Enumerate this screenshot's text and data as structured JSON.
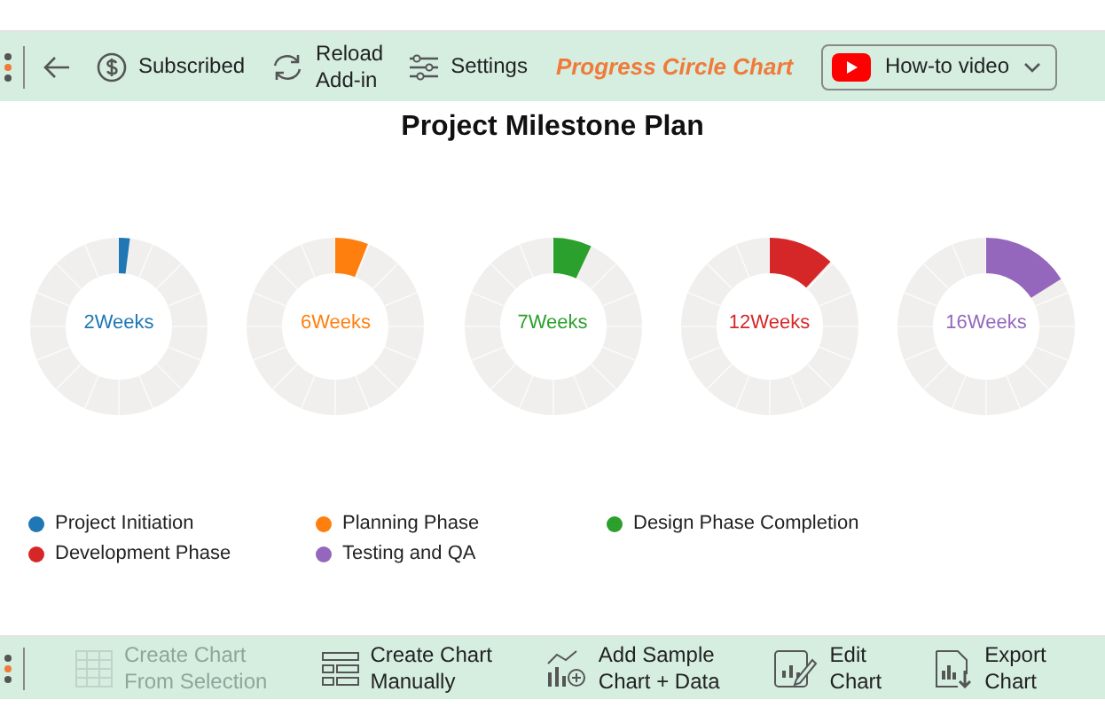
{
  "toolbar": {
    "buttons": [
      {
        "label": "Subscribed"
      },
      {
        "label": "Reload\nAdd-in"
      },
      {
        "label": "Settings"
      }
    ],
    "app_title": "Progress Circle Chart",
    "video_button": {
      "label": "How-to video"
    }
  },
  "chart": {
    "title": "Project Milestone Plan",
    "rings": [
      {
        "label": "2Weeks",
        "color": "#1f77b4"
      },
      {
        "label": "6Weeks",
        "color": "#ff7f0e"
      },
      {
        "label": "7Weeks",
        "color": "#2ca02c"
      },
      {
        "label": "12Weeks",
        "color": "#d62728"
      },
      {
        "label": "16Weeks",
        "color": "#9467bd"
      }
    ],
    "legend": [
      {
        "label": "Project Initiation",
        "color": "#1f77b4"
      },
      {
        "label": "Planning Phase",
        "color": "#ff7f0e"
      },
      {
        "label": "Design Phase Completion",
        "color": "#2ca02c"
      },
      {
        "label": "Development Phase",
        "color": "#d62728"
      },
      {
        "label": "Testing and QA",
        "color": "#9467bd"
      }
    ]
  },
  "bottom_toolbar": {
    "buttons": [
      {
        "label": "Create Chart\nFrom Selection",
        "disabled": true
      },
      {
        "label": "Create Chart\nManually",
        "disabled": false
      },
      {
        "label": "Add Sample\nChart + Data",
        "disabled": false
      },
      {
        "label": "Edit\nChart",
        "disabled": false
      },
      {
        "label": "Export\nChart",
        "disabled": false
      }
    ]
  }
}
